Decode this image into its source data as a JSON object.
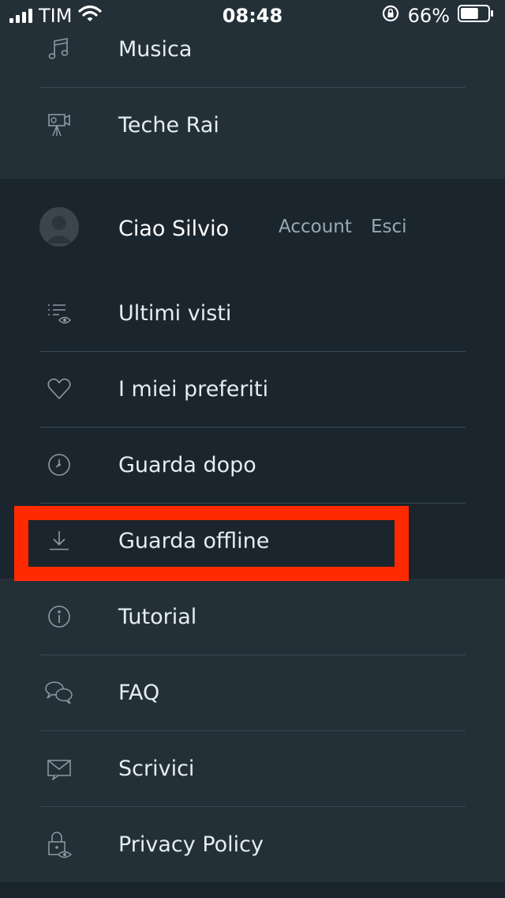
{
  "status_bar": {
    "carrier": "TIM",
    "time": "08:48",
    "battery": "66%",
    "battery_level": 0.66,
    "icons": [
      "signal-icon",
      "wifi-icon",
      "rotation-lock-icon",
      "battery-icon"
    ]
  },
  "menu_top": [
    {
      "label": "Musica",
      "icon": "music-note-icon"
    },
    {
      "label": "Teche Rai",
      "icon": "video-camera-icon"
    }
  ],
  "user": {
    "greeting": "Ciao Silvio",
    "account": "Account",
    "logout": "Esci",
    "icon": "avatar-icon"
  },
  "menu_user": [
    {
      "label": "Ultimi visti",
      "icon": "list-eye-icon"
    },
    {
      "label": "I miei preferiti",
      "icon": "heart-icon"
    },
    {
      "label": "Guarda dopo",
      "icon": "clock-icon"
    },
    {
      "label": "Guarda offline",
      "icon": "download-icon"
    }
  ],
  "menu_bottom": [
    {
      "label": "Tutorial",
      "icon": "info-icon"
    },
    {
      "label": "FAQ",
      "icon": "chat-bubbles-icon"
    },
    {
      "label": "Scrivici",
      "icon": "envelope-icon"
    },
    {
      "label": "Privacy Policy",
      "icon": "lock-eye-icon"
    }
  ],
  "colors": {
    "section_light": "#243038",
    "section_dark": "#1b252d",
    "highlight": "#ff2a00",
    "text": "#e6edf1",
    "muted_text": "#9aa8b1"
  }
}
